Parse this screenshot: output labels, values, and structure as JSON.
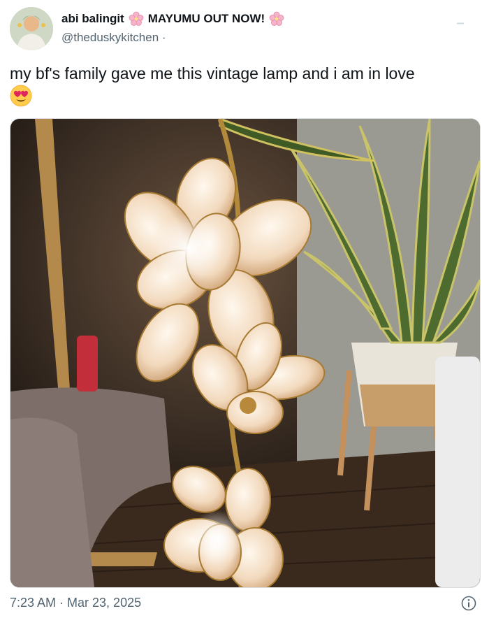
{
  "author": {
    "display_name": "abi balingit",
    "promo_text": "MAYUMU OUT NOW!",
    "handle": "@theduskykitchen",
    "separator": "·"
  },
  "tweet": {
    "text": "my bf's family gave me this vintage lamp and i am in love",
    "emoji": "heart-eyes-emoji"
  },
  "media": {
    "subject": "vintage-flower-lamp-photo"
  },
  "footer": {
    "timestamp": "7:23 AM · Mar 23, 2025"
  },
  "icons": {
    "flower": "cherry-blossom-icon",
    "info": "info-icon",
    "more": "more-dots-icon"
  },
  "colors": {
    "text": "#0f1419",
    "muted": "#536471",
    "blossom": "#f4a7c4"
  }
}
